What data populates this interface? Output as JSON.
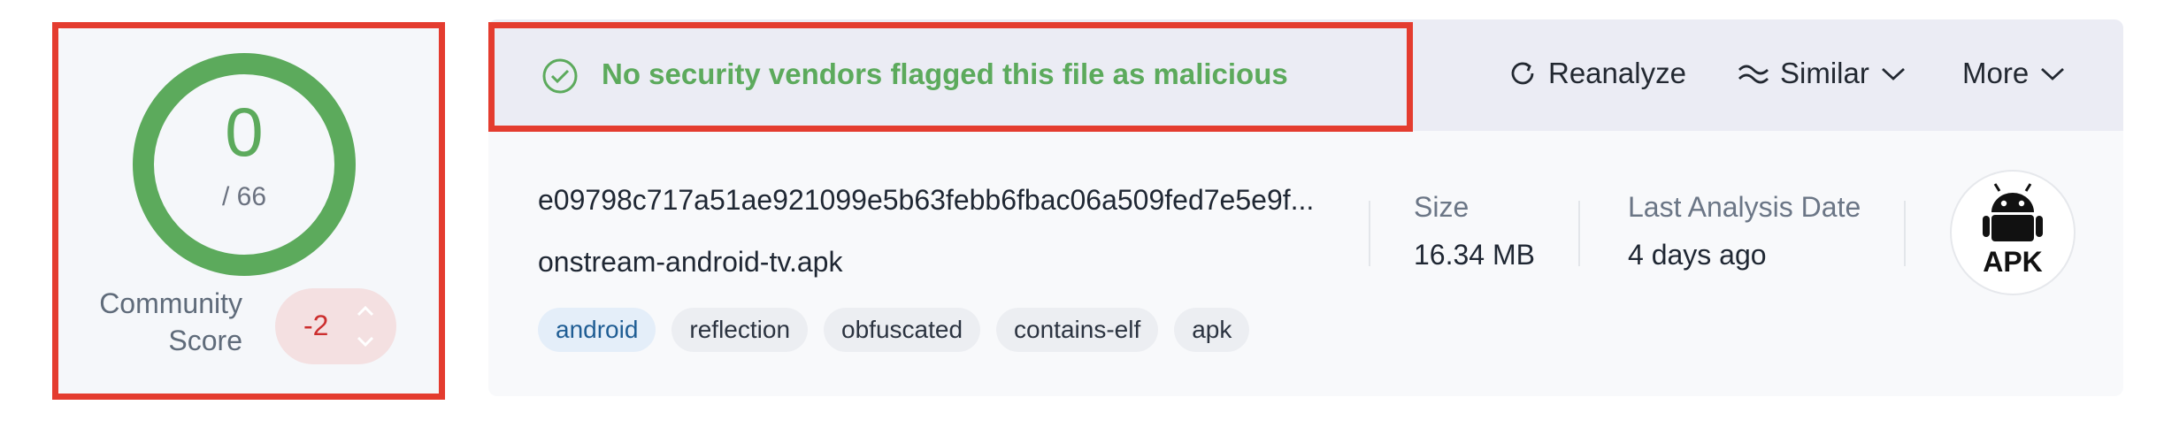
{
  "score": {
    "detections": "0",
    "total": "/ 66",
    "community_label": "Community Score",
    "community_value": "-2",
    "ring_color": "#5caa5c"
  },
  "banner": {
    "message": "No security vendors flagged this file as malicious",
    "icon": "check-circle-icon",
    "color": "#5caa5c"
  },
  "actions": {
    "reanalyze": "Reanalyze",
    "similar": "Similar",
    "more": "More"
  },
  "file": {
    "hash": "e09798c717a51ae921099e5b63febb6fbac06a509fed7e5e9f...",
    "name": "onstream-android-tv.apk",
    "tags": [
      "android",
      "reflection",
      "obfuscated",
      "contains-elf",
      "apk"
    ]
  },
  "meta": {
    "size_label": "Size",
    "size_value": "16.34 MB",
    "date_label": "Last Analysis Date",
    "date_value": "4 days ago"
  },
  "file_type": {
    "label": "APK",
    "icon": "android-icon"
  },
  "highlight_color": "#e43c2f"
}
